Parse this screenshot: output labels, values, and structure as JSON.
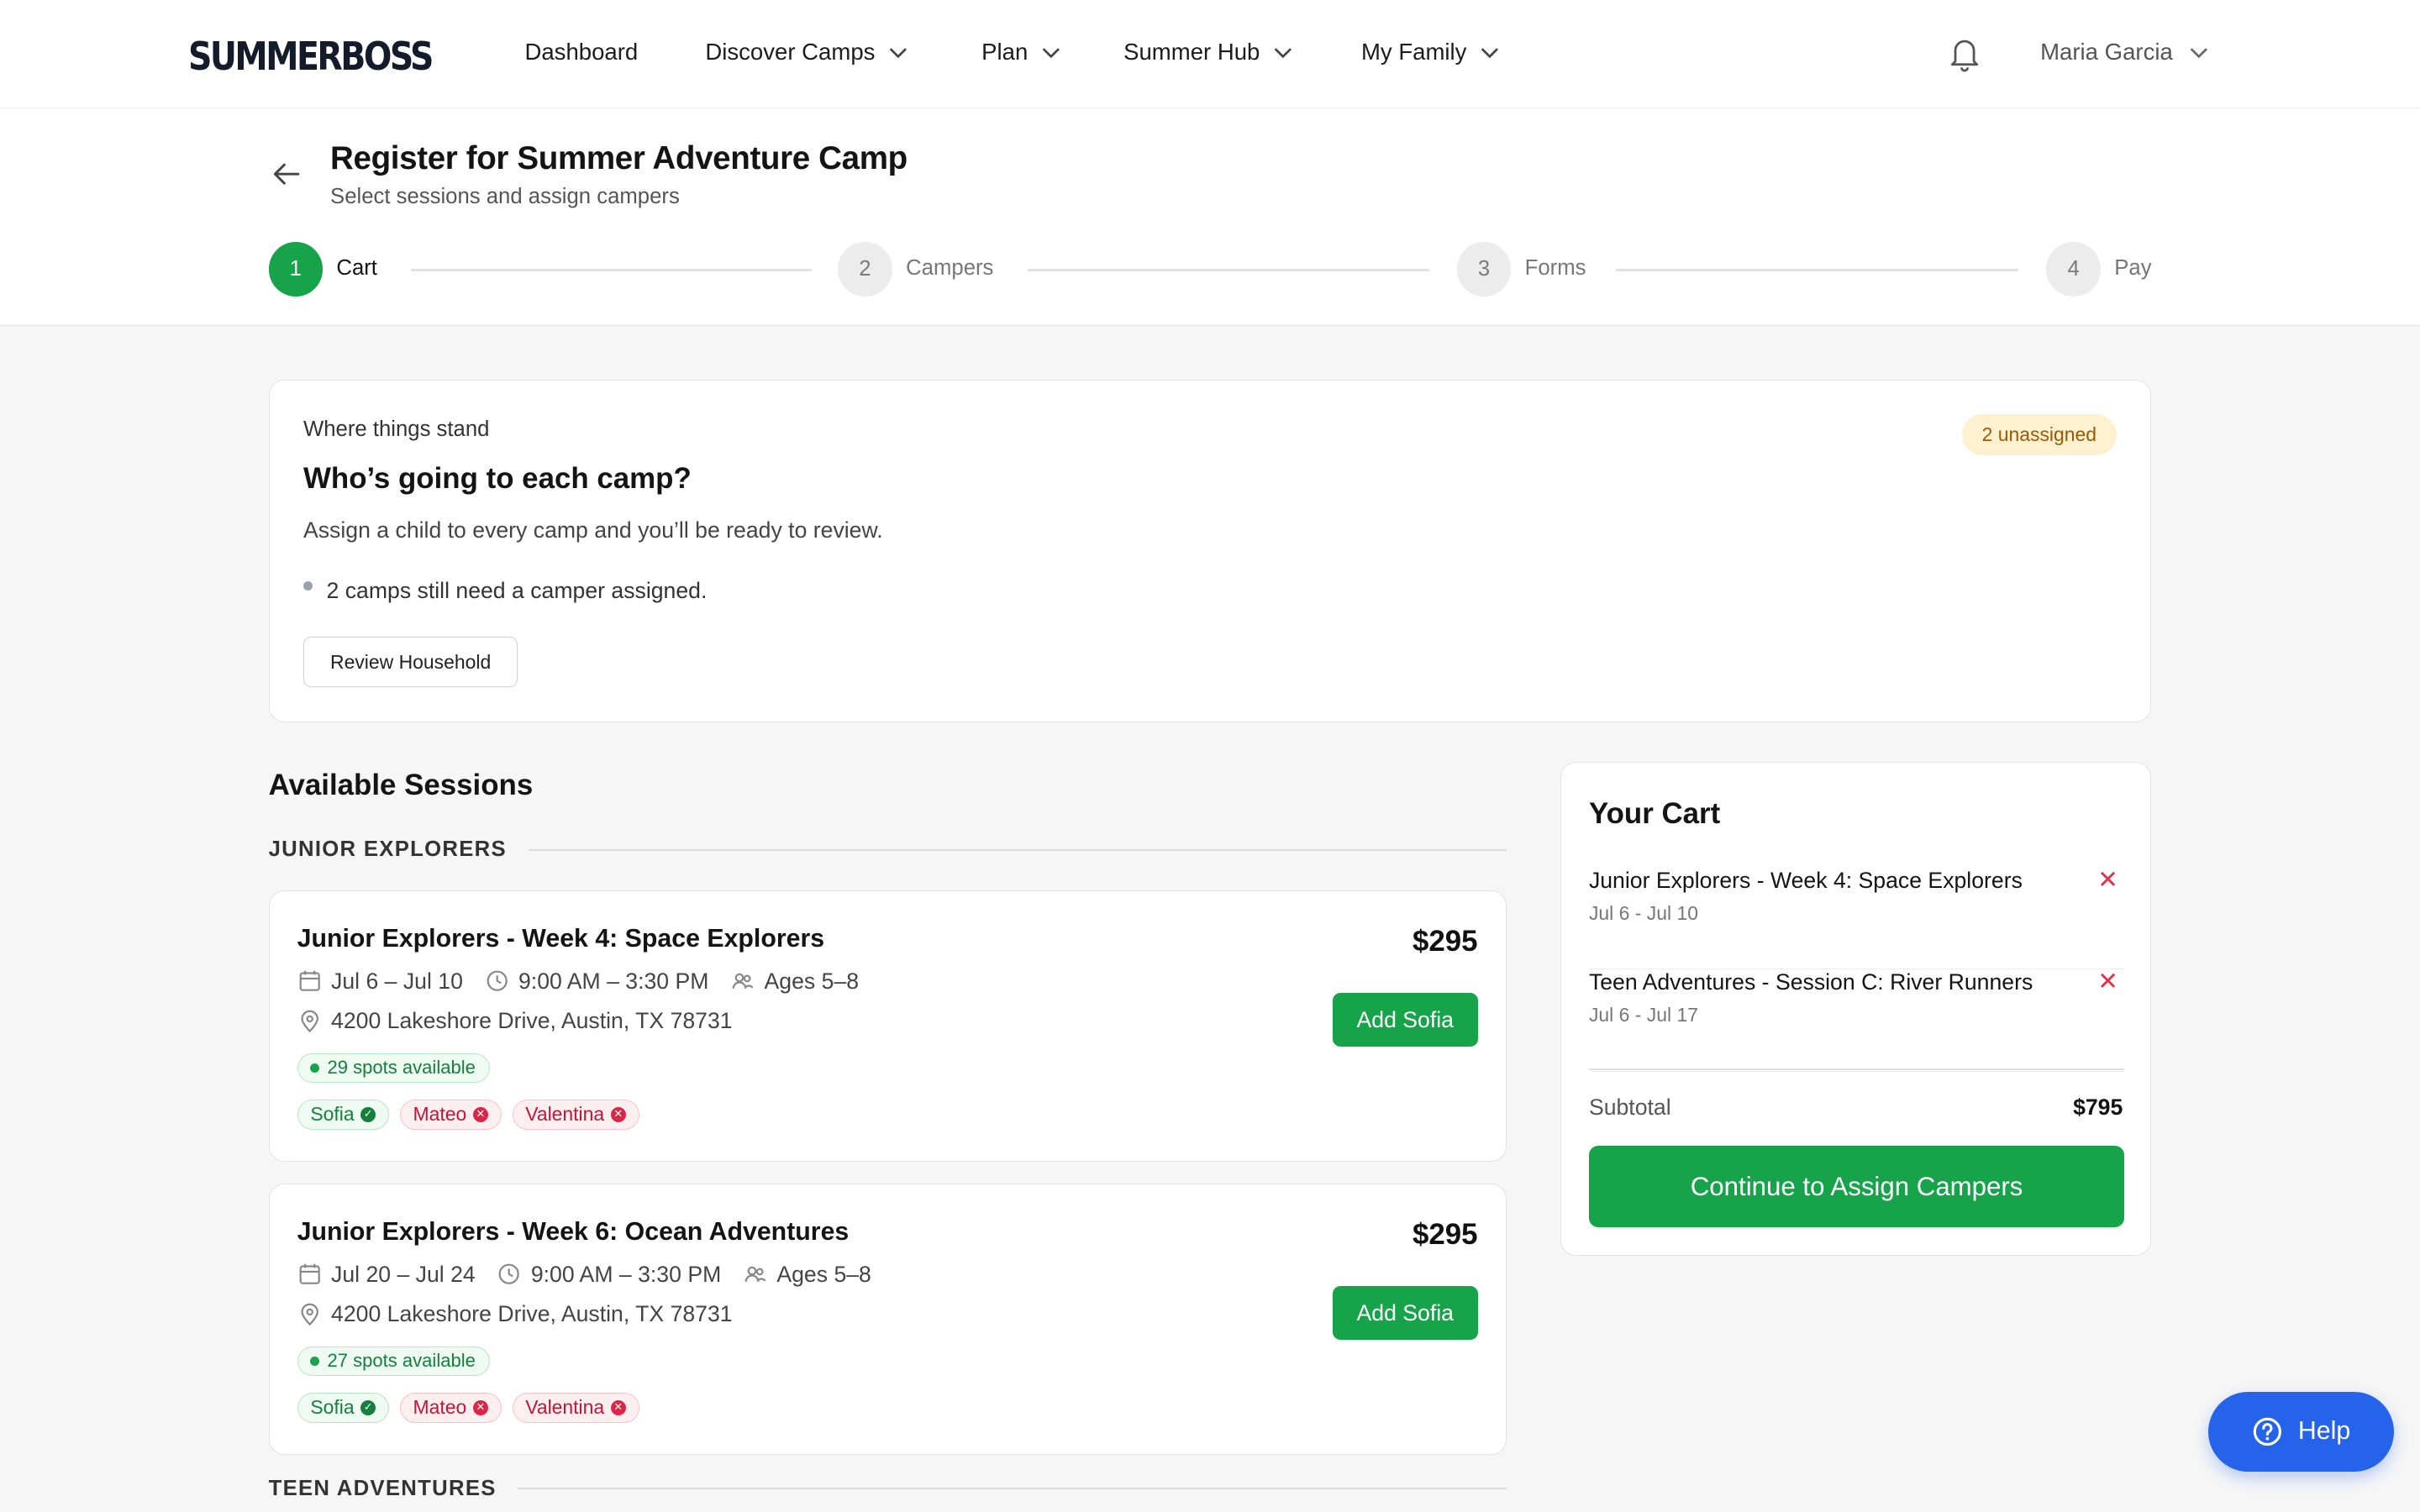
{
  "brand": "SUMMERBOSS",
  "nav": {
    "dashboard": "Dashboard",
    "discover": "Discover Camps",
    "plan": "Plan",
    "hub": "Summer Hub",
    "family": "My Family",
    "user": "Maria Garcia"
  },
  "header": {
    "title": "Register for Summer Adventure Camp",
    "subtitle": "Select sessions and assign campers"
  },
  "steps": [
    {
      "num": "1",
      "label": "Cart"
    },
    {
      "num": "2",
      "label": "Campers"
    },
    {
      "num": "3",
      "label": "Forms"
    },
    {
      "num": "4",
      "label": "Pay"
    }
  ],
  "status": {
    "eyebrow": "Where things stand",
    "heading": "Who’s going to each camp?",
    "description": "Assign a child to every camp and you’ll be ready to review.",
    "bullet": "2 camps still need a camper assigned.",
    "review_button": "Review Household",
    "badge": "2 unassigned"
  },
  "sessions": {
    "title": "Available Sessions",
    "groups": [
      "JUNIOR EXPLORERS",
      "TEEN ADVENTURES"
    ],
    "cards": [
      {
        "name": "Junior Explorers - Week 4: Space Explorers",
        "dates": "Jul 6 – Jul 10",
        "time": "9:00 AM – 3:30 PM",
        "ages": "Ages 5–8",
        "location": "4200 Lakeshore Drive, Austin, TX 78731",
        "spots": "29 spots available",
        "price": "$295",
        "button": "Add Sofia",
        "campers": [
          "Sofia",
          "Mateo",
          "Valentina"
        ]
      },
      {
        "name": "Junior Explorers - Week 6: Ocean Adventures",
        "dates": "Jul 20 – Jul 24",
        "time": "9:00 AM – 3:30 PM",
        "ages": "Ages 5–8",
        "location": "4200 Lakeshore Drive, Austin, TX 78731",
        "spots": "27 spots available",
        "price": "$295",
        "button": "Add Sofia",
        "campers": [
          "Sofia",
          "Mateo",
          "Valentina"
        ]
      }
    ]
  },
  "cart": {
    "title": "Your Cart",
    "items": [
      {
        "name": "Junior Explorers - Week 4: Space Explorers",
        "dates": "Jul 6 - Jul 10"
      },
      {
        "name": "Teen Adventures - Session C: River Runners",
        "dates": "Jul 6 - Jul 17"
      }
    ],
    "subtotal_label": "Subtotal",
    "subtotal_value": "$795",
    "continue_button": "Continue to Assign Campers"
  },
  "help": "Help",
  "colors": {
    "brand_green": "#16a34a",
    "help_blue": "#2563eb",
    "badge_amber": "#fdf1cf",
    "error_red": "#dc2647"
  }
}
